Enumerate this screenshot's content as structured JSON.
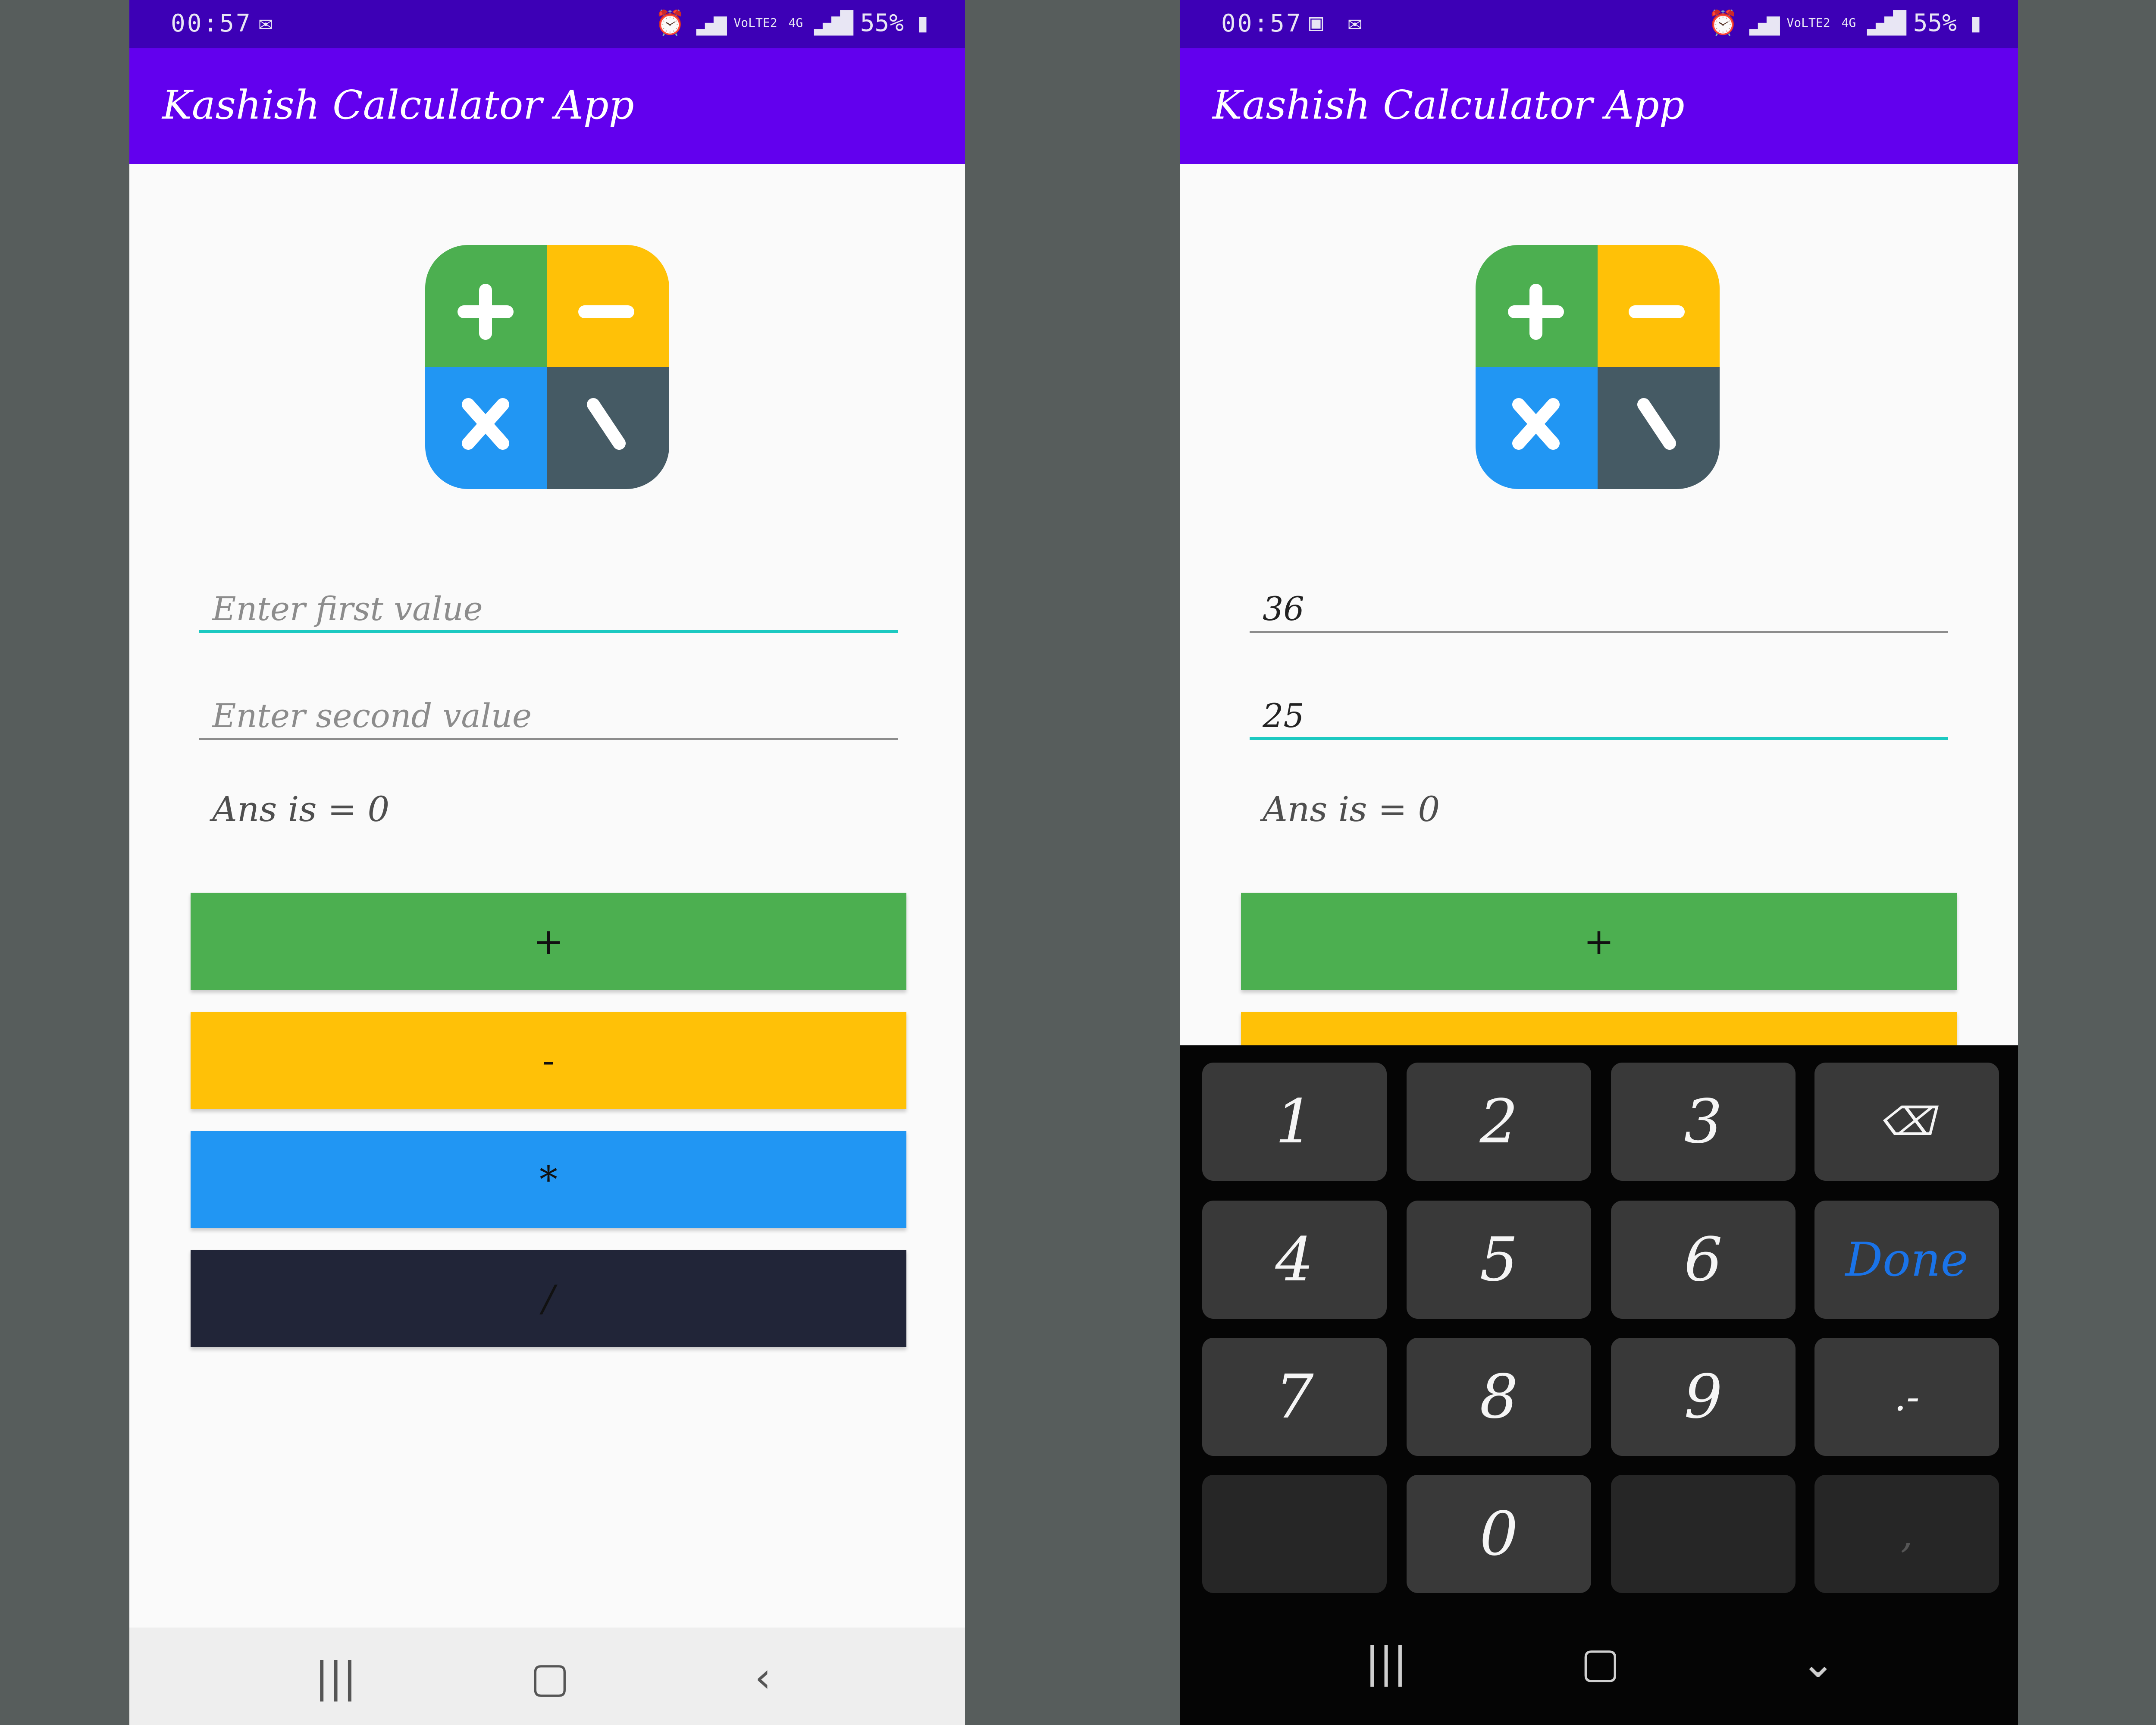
{
  "status_bar": {
    "time": "00:57",
    "battery": "55%",
    "network": "4G",
    "volte": "VoLTE2",
    "icons": [
      "gmail-icon",
      "alarm-icon",
      "signal-icon",
      "battery-icon"
    ]
  },
  "app": {
    "title": "Kashish Calculator App",
    "logo_colors": {
      "plus": "#4caf50",
      "minus": "#ffc107",
      "times": "#2196f3",
      "divide": "#455a64"
    }
  },
  "screen1": {
    "first_placeholder": "Enter first value",
    "second_placeholder": "Enter second value",
    "first_value": "",
    "second_value": "",
    "answer": "Ans is = 0",
    "buttons": {
      "add": "+",
      "subtract": "-",
      "multiply": "*",
      "divide": "/"
    }
  },
  "screen2": {
    "first_value": "36",
    "second_value": "25",
    "answer": "Ans is = 0",
    "buttons": {
      "add": "+"
    },
    "keyboard": {
      "keys": [
        "1",
        "2",
        "3",
        "4",
        "5",
        "6",
        "7",
        "8",
        "9",
        "0"
      ],
      "done": "Done",
      "decimal_minus": ".-",
      "comma": ","
    }
  },
  "colors": {
    "status_bar": "#3d00b6",
    "app_bar": "#6200ee",
    "add": "#4caf50",
    "subtract": "#ffc107",
    "multiply": "#2196f3",
    "divide": "#212538",
    "focus_line": "#1cc9c1"
  }
}
